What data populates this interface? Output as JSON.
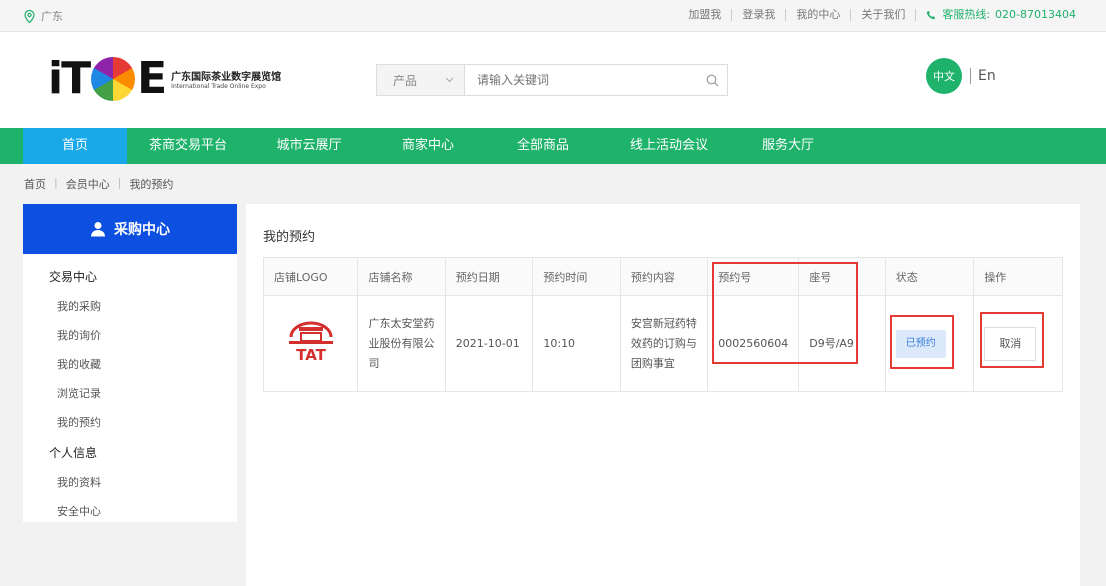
{
  "topbar": {
    "location": "广东",
    "links": [
      "加盟我",
      "登录我",
      "我的中心",
      "关于我们"
    ],
    "hotline_label": "客服热线:",
    "hotline_number": "020-87013404"
  },
  "header": {
    "logo_left": "iT",
    "logo_right": "E",
    "logo_cn": "广东国际茶业数字展览馆",
    "logo_en": "International Trade Online Expo",
    "search_category": "产品",
    "search_placeholder": "请输入关键词",
    "lang_zh": "中文",
    "lang_en": "En"
  },
  "nav": {
    "items": [
      "首页",
      "茶商交易平台",
      "城市云展厅",
      "商家中心",
      "全部商品",
      "线上活动会议",
      "服务大厅"
    ],
    "active_index": 0
  },
  "breadcrumb": [
    "首页",
    "会员中心",
    "我的预约"
  ],
  "sidebar": {
    "title": "采购中心",
    "groups": [
      {
        "label": "交易中心",
        "items": [
          "我的采购",
          "我的询价",
          "我的收藏",
          "浏览记录",
          "我的预约"
        ]
      },
      {
        "label": "个人信息",
        "items": [
          "我的资料",
          "安全中心"
        ]
      }
    ]
  },
  "main": {
    "title": "我的预约",
    "columns": [
      "店铺LOGO",
      "店铺名称",
      "预约日期",
      "预约时间",
      "预约内容",
      "预约号",
      "座号",
      "状态",
      "操作"
    ],
    "rows": [
      {
        "logo_text": "TAT",
        "shop_name": "广东太安堂药业股份有限公司",
        "date": "2021-10-01",
        "time": "10:10",
        "content": "安宫新冠药特效药的订购与团购事宜",
        "booking_no": "0002560604",
        "seat": "D9号/A9",
        "status": "已预约",
        "action": "取消"
      }
    ]
  }
}
